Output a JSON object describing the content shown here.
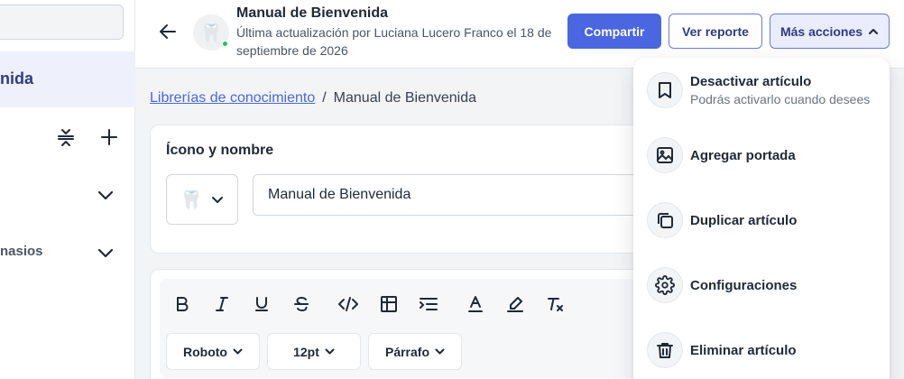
{
  "sidebar": {
    "active_item": "nida",
    "row_label": "nasios"
  },
  "header": {
    "title": "Manual de Bienvenida",
    "subtitle": "Última actualización por Luciana Lucero Franco el 18 de septiembre de 2026",
    "avatar_emoji": "🦷",
    "share_label": "Compartir",
    "report_label": "Ver reporte",
    "more_label": "Más acciones"
  },
  "breadcrumb": {
    "link": "Librerías de conocimiento",
    "separator": "/",
    "current": "Manual de Bienvenida"
  },
  "name_card": {
    "label": "Ícono y nombre",
    "emoji": "🦷",
    "name_value": "Manual de Bienvenida"
  },
  "toolbar": {
    "font": "Roboto",
    "size": "12pt",
    "block": "Párrafo"
  },
  "menu": {
    "items": [
      {
        "label": "Desactivar artículo",
        "sub": "Podrás activarlo cuando desees",
        "icon": "bookmark-icon"
      },
      {
        "label": "Agregar portada",
        "icon": "image-icon"
      },
      {
        "label": "Duplicar artículo",
        "icon": "copy-icon"
      },
      {
        "label": "Configuraciones",
        "icon": "gear-icon"
      },
      {
        "label": "Eliminar artículo",
        "icon": "trash-icon"
      }
    ]
  },
  "colors": {
    "primary": "#4a66e0",
    "accent_text": "#2f3a87",
    "online_dot": "#22c55e"
  }
}
